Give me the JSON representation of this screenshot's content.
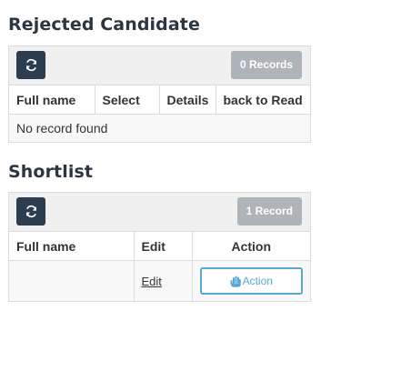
{
  "rejected": {
    "title": "Rejected Candidate",
    "records_badge": "0 Records",
    "columns": [
      "Full name",
      "Select",
      "Details",
      "back to Read"
    ],
    "empty_message": "No record found"
  },
  "shortlist": {
    "title": "Shortlist",
    "records_badge": "1 Record",
    "columns": [
      "Full name",
      "Edit",
      "Action"
    ],
    "rows": [
      {
        "full_name": "",
        "edit_label": "Edit",
        "action_label": "Action"
      }
    ]
  },
  "icons": {
    "refresh": "refresh-icon",
    "hand": "hand-pointer-icon"
  },
  "colors": {
    "title": "#2b3641",
    "refresh_button": "#2b3d4f",
    "records_badge": "#aeb4b7",
    "action_accent": "#5aa7d3",
    "toolbar_bg": "#f0f0f0",
    "row_bg": "#f8f8f8"
  }
}
